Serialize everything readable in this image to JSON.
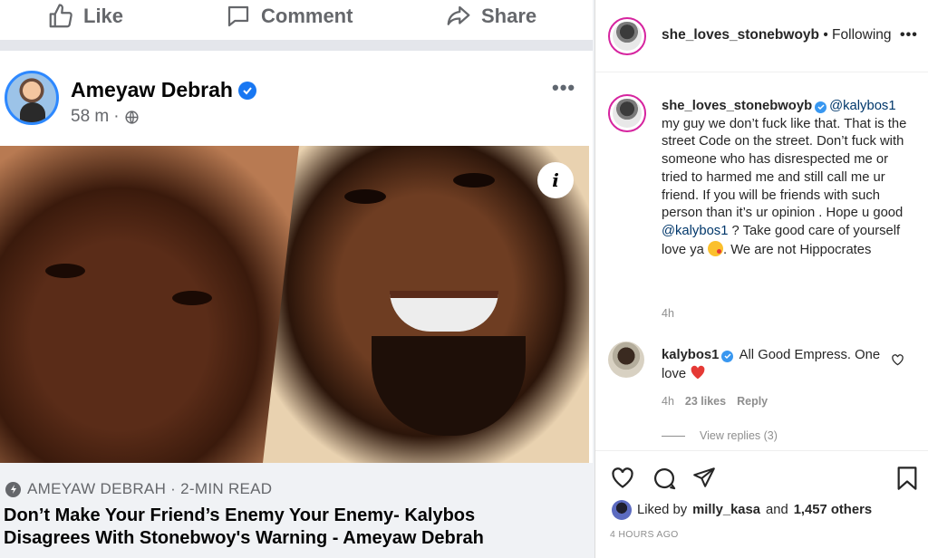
{
  "facebook": {
    "actions": {
      "like": "Like",
      "comment": "Comment",
      "share": "Share"
    },
    "post": {
      "author": "Ameyaw Debrah",
      "time": "58 m",
      "separator": "·",
      "more": "•••"
    },
    "link": {
      "source": "AMEYAW DEBRAH · 2-MIN READ",
      "headline_line1": "Don’t Make Your Friend’s Enemy Your Enemy- Kalybos",
      "headline_line2": "Disagrees With Stonebwoy's Warning - Ameyaw Debrah",
      "info_icon": "i"
    }
  },
  "instagram": {
    "header": {
      "username": "she_loves_stonebwoyb",
      "follow_status": "• Following",
      "more": "•••"
    },
    "caption": {
      "username": "she_loves_stonebwoyb",
      "mention1": "@kalybos1",
      "text1": "my guy we don’t fuck like that. That is the street Code on the street. Don’t fuck with someone who has disrespected me or tried to harmed me and still call me ur friend. If you will be friends with such person than it’s ur opinion . Hope u good",
      "mention2": "@kalybos1",
      "text2": "? Take good care of yourself love ya",
      "text3": ". We are not Hippocrates",
      "time": "4h"
    },
    "reply": {
      "username": "kalybos1",
      "text": "All Good Empress. One love",
      "time": "4h",
      "likes": "23 likes",
      "reply_label": "Reply",
      "view_replies": "View replies (3)"
    },
    "footer": {
      "liked_by_prefix": "Liked by",
      "liked_by_user": "milly_kasa",
      "liked_by_and": "and",
      "liked_by_others": "1,457 others",
      "posted": "4 HOURS AGO"
    },
    "colors": {
      "mention": "#00376b",
      "meta": "#8e8e8e",
      "heart": "#e53935"
    }
  }
}
